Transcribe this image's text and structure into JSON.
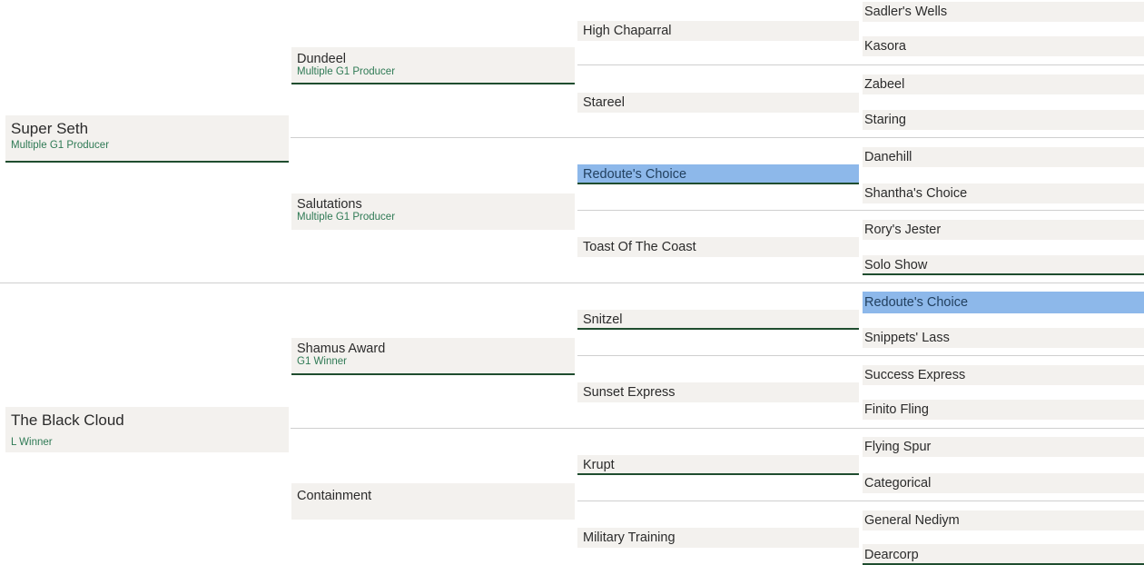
{
  "pedigree": {
    "sire": {
      "name": "Super Seth",
      "note": "Multiple G1 Producer",
      "sire": {
        "name": "Dundeel",
        "note": "Multiple G1 Producer",
        "sire": {
          "name": "High Chaparral",
          "sire": {
            "name": "Sadler's Wells"
          },
          "dam": {
            "name": "Kasora"
          }
        },
        "dam": {
          "name": "Stareel",
          "sire": {
            "name": "Zabeel"
          },
          "dam": {
            "name": "Staring"
          }
        }
      },
      "dam": {
        "name": "Salutations",
        "note": "Multiple G1 Producer",
        "sire": {
          "name": "Redoute's Choice",
          "sire": {
            "name": "Danehill"
          },
          "dam": {
            "name": "Shantha's Choice"
          }
        },
        "dam": {
          "name": "Toast Of The Coast",
          "sire": {
            "name": "Rory's Jester"
          },
          "dam": {
            "name": "Solo Show"
          }
        }
      }
    },
    "dam": {
      "name": "The Black Cloud",
      "note": "L Winner",
      "sire": {
        "name": "Shamus Award",
        "note": "G1 Winner",
        "sire": {
          "name": "Snitzel",
          "sire": {
            "name": "Redoute's Choice"
          },
          "dam": {
            "name": "Snippets' Lass"
          }
        },
        "dam": {
          "name": "Sunset Express",
          "sire": {
            "name": "Success Express"
          },
          "dam": {
            "name": "Finito Fling"
          }
        }
      },
      "dam": {
        "name": "Containment",
        "sire": {
          "name": "Krupt",
          "sire": {
            "name": "Flying Spur"
          },
          "dam": {
            "name": "Categorical"
          }
        },
        "dam": {
          "name": "Military Training",
          "sire": {
            "name": "General Nediym"
          },
          "dam": {
            "name": "Dearcorp"
          }
        }
      }
    }
  },
  "colors": {
    "box_bg": "#f3f1ee",
    "highlight": "#8db8ea",
    "underline": "#1f4d2f",
    "note_text": "#2f7a55"
  }
}
